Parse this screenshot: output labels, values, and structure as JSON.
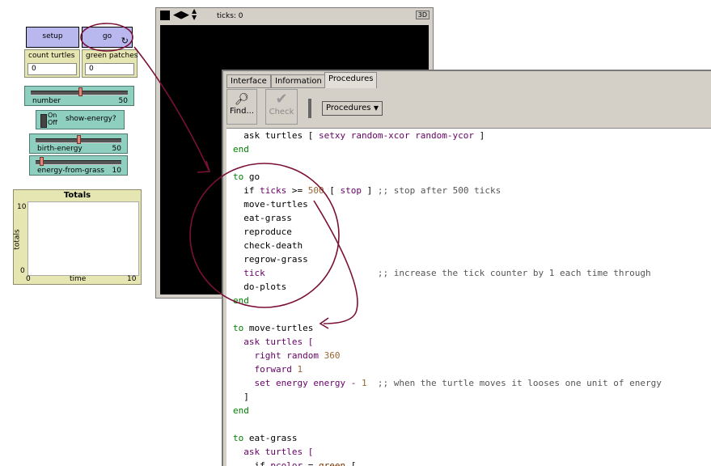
{
  "interface": {
    "setup_button": "setup",
    "go_button": "go",
    "monitors": [
      {
        "label": "count turtles",
        "value": "0"
      },
      {
        "label": "green patches",
        "value": "0"
      }
    ],
    "number_slider": {
      "label": "number",
      "value": "50"
    },
    "energy_switch": {
      "state_on": "On",
      "state_off": "Off",
      "label": "show-energy?"
    },
    "birth_slider": {
      "label": "birth-energy",
      "value": "50"
    },
    "grass_slider": {
      "label": "energy-from-grass",
      "value": "10"
    },
    "plot": {
      "title": "Totals",
      "ylabel": "totals",
      "xlabel": "time",
      "ymax": "10",
      "ymin": "0",
      "xmin": "0",
      "xmax": "10"
    }
  },
  "view": {
    "ticks_label": "ticks: 0",
    "button_3d": "3D"
  },
  "tabs": [
    "Interface",
    "Information",
    "Procedures"
  ],
  "toolbar": {
    "find": "Find...",
    "check": "Check",
    "procedures_dropdown": "Procedures"
  },
  "code_lines": [
    {
      "indent": "  ",
      "parts": [
        [
          "ask turtles [ ",
          "k"
        ],
        [
          "setxy ",
          "p"
        ],
        [
          "random-xcor random-ycor",
          "p"
        ],
        [
          " ]",
          "k"
        ]
      ]
    },
    {
      "indent": "",
      "parts": [
        [
          "end",
          "kw"
        ]
      ]
    },
    {
      "indent": "",
      "parts": [
        [
          "",
          "k"
        ]
      ]
    },
    {
      "indent": "",
      "parts": [
        [
          "to ",
          "kw"
        ],
        [
          "go",
          "k"
        ]
      ]
    },
    {
      "indent": "  ",
      "parts": [
        [
          "if ",
          "k"
        ],
        [
          "ticks",
          "p"
        ],
        [
          " >= ",
          "k"
        ],
        [
          "500",
          "n"
        ],
        [
          " [ ",
          "k"
        ],
        [
          "stop",
          "p"
        ],
        [
          " ] ",
          "k"
        ],
        [
          ";; stop after 500 ticks",
          "c"
        ]
      ]
    },
    {
      "indent": "  ",
      "parts": [
        [
          "move-turtles",
          "k"
        ]
      ]
    },
    {
      "indent": "  ",
      "parts": [
        [
          "eat-grass",
          "k"
        ]
      ]
    },
    {
      "indent": "  ",
      "parts": [
        [
          "reproduce",
          "k"
        ]
      ]
    },
    {
      "indent": "  ",
      "parts": [
        [
          "check-death",
          "k"
        ]
      ]
    },
    {
      "indent": "  ",
      "parts": [
        [
          "regrow-grass",
          "k"
        ]
      ]
    },
    {
      "indent": "  ",
      "parts": [
        [
          "tick",
          "p"
        ],
        [
          "                     ",
          "k"
        ],
        [
          ";; increase the tick counter by 1 each time through",
          "c"
        ]
      ]
    },
    {
      "indent": "  ",
      "parts": [
        [
          "do-plots",
          "k"
        ]
      ]
    },
    {
      "indent": "",
      "parts": [
        [
          "end",
          "kw"
        ]
      ]
    },
    {
      "indent": "",
      "parts": [
        [
          "",
          "k"
        ]
      ]
    },
    {
      "indent": "",
      "parts": [
        [
          "to ",
          "kw"
        ],
        [
          "move-turtles",
          "k"
        ]
      ]
    },
    {
      "indent": "  ",
      "parts": [
        [
          "ask turtles [",
          "p"
        ]
      ]
    },
    {
      "indent": "    ",
      "parts": [
        [
          "right random ",
          "p"
        ],
        [
          "360",
          "n"
        ]
      ]
    },
    {
      "indent": "    ",
      "parts": [
        [
          "forward ",
          "p"
        ],
        [
          "1",
          "n"
        ]
      ]
    },
    {
      "indent": "    ",
      "parts": [
        [
          "set energy energy - ",
          "p"
        ],
        [
          "1",
          "n"
        ],
        [
          "  ",
          "k"
        ],
        [
          ";; when the turtle moves it looses one unit of energy",
          "c"
        ]
      ]
    },
    {
      "indent": "  ",
      "parts": [
        [
          "]",
          "k"
        ]
      ]
    },
    {
      "indent": "",
      "parts": [
        [
          "end",
          "kw"
        ]
      ]
    },
    {
      "indent": "",
      "parts": [
        [
          "",
          "k"
        ]
      ]
    },
    {
      "indent": "",
      "parts": [
        [
          "to ",
          "kw"
        ],
        [
          "eat-grass",
          "k"
        ]
      ]
    },
    {
      "indent": "  ",
      "parts": [
        [
          "ask turtles [",
          "p"
        ]
      ]
    },
    {
      "indent": "    ",
      "parts": [
        [
          "if ",
          "k"
        ],
        [
          "pcolor",
          "p"
        ],
        [
          " = ",
          "k"
        ],
        [
          "green",
          "g"
        ],
        [
          " [",
          "k"
        ]
      ]
    }
  ],
  "colors": {
    "keyword": "#008000",
    "primitive": "#660066",
    "number": "#996633",
    "comment": "#555555",
    "constant": "#7f3300",
    "annotation": "#7a1038"
  }
}
